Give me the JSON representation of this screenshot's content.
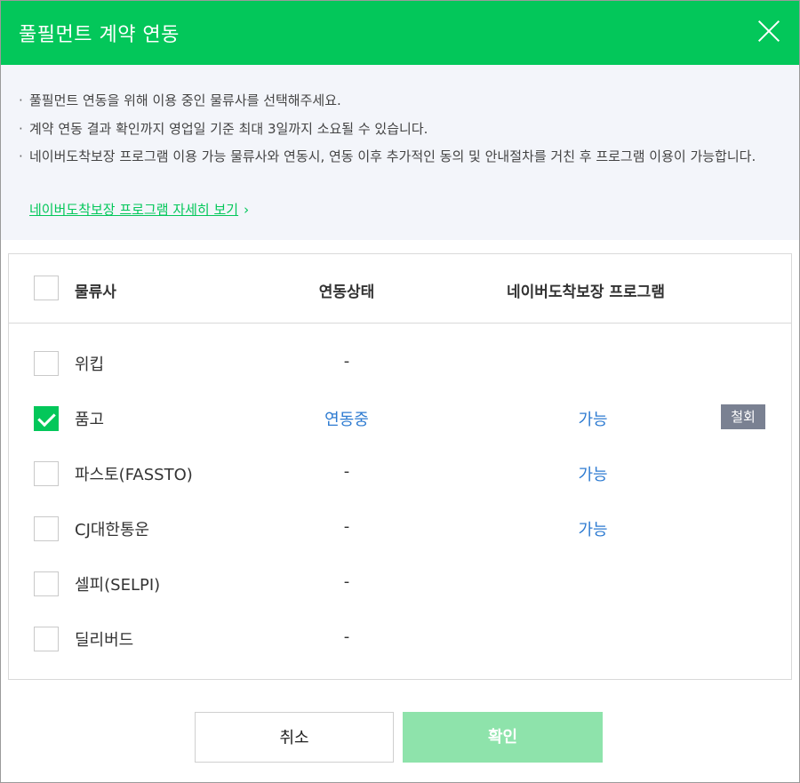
{
  "dialog": {
    "title": "풀필먼트 계약 연동",
    "colors": {
      "brand": "#03c75a",
      "link": "#2e7bd1",
      "revoke": "#7a8192",
      "confirm_disabled": "#8ee3ab"
    }
  },
  "notice": {
    "items": [
      "풀필먼트 연동을 위해 이용 중인 물류사를 선택해주세요.",
      "계약 연동 결과 확인까지 영업일 기준 최대 3일까지 소요될 수 있습니다.",
      "네이버도착보장 프로그램 이용 가능 물류사와 연동시, 연동 이후 추가적인 동의 및 안내절차를 거친 후 프로그램 이용이 가능합니다."
    ],
    "link": "네이버도착보장 프로그램 자세히 보기",
    "link_arrow": "›"
  },
  "table": {
    "headers": {
      "company": "물류사",
      "status": "연동상태",
      "program": "네이버도착보장 프로그램"
    },
    "rows": [
      {
        "name": "위킵",
        "status": "-",
        "program": "",
        "checked": false
      },
      {
        "name": "품고",
        "status": "연동중",
        "program": "가능",
        "checked": true,
        "action": "철회"
      },
      {
        "name": "파스토(FASSTO)",
        "status": "-",
        "program": "가능",
        "checked": false
      },
      {
        "name": "CJ대한통운",
        "status": "-",
        "program": "가능",
        "checked": false
      },
      {
        "name": "셀피(SELPI)",
        "status": "-",
        "program": "",
        "checked": false
      },
      {
        "name": "딜리버드",
        "status": "-",
        "program": "",
        "checked": false
      }
    ]
  },
  "footer": {
    "cancel": "취소",
    "confirm": "확인"
  }
}
